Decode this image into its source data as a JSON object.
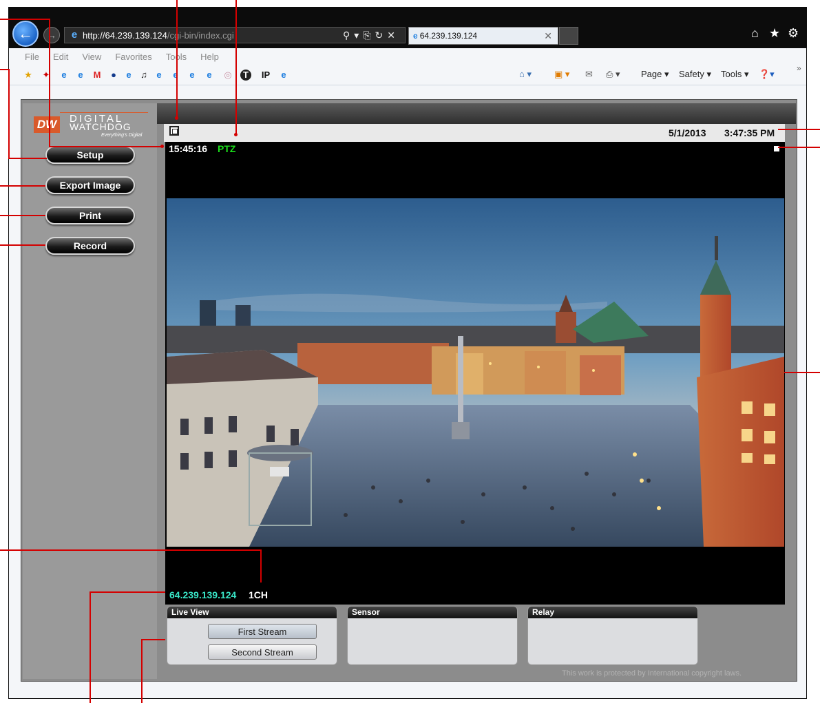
{
  "browser": {
    "address_url_host": "http://64.239.139.124",
    "address_url_path": "/cgi-bin/index.cgi",
    "tab_title": "64.239.139.124",
    "menu": [
      "File",
      "Edit",
      "View",
      "Favorites",
      "Tools",
      "Help"
    ],
    "commands": {
      "page": "Page ▾",
      "safety": "Safety ▾",
      "tools": "Tools ▾"
    }
  },
  "app": {
    "logo": {
      "line1": "DIGITAL",
      "line2": "WATCHDOG",
      "tagline": "Everything's Digital",
      "mark": "DW"
    },
    "sidebar_buttons": [
      "Setup",
      "Export Image",
      "Print",
      "Record"
    ],
    "date": "5/1/2013",
    "time": "3:47:35 PM",
    "camera_time": "15:45:16",
    "ptz_label": "PTZ",
    "camera_ip": "64.239.139.124",
    "channel": "1CH",
    "panels": {
      "live_view": {
        "title": "Live View",
        "first_stream": "First Stream",
        "second_stream": "Second Stream"
      },
      "sensor": {
        "title": "Sensor"
      },
      "relay": {
        "title": "Relay"
      }
    },
    "copyright": "This work is protected by International copyright laws."
  },
  "colors": {
    "ptz": "#1ae01a",
    "ip": "#39e6c8",
    "callout": "#d40000",
    "logo_accent": "#d95a2b"
  }
}
